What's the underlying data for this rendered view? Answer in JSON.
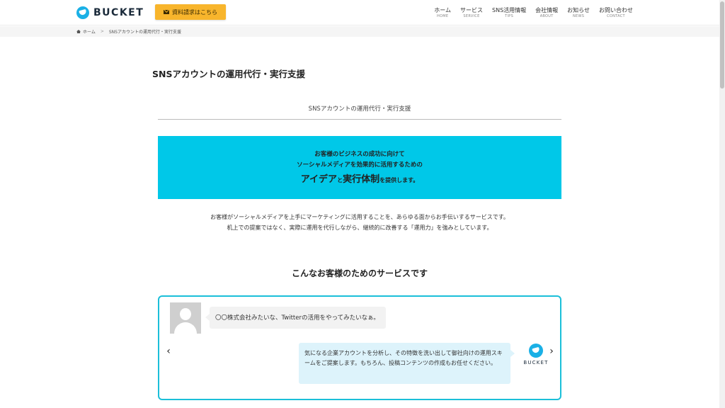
{
  "header": {
    "logo_text": "BUCKET",
    "cta_label": "資料請求はこちら",
    "nav": [
      {
        "jp": "ホーム",
        "en": "HOME"
      },
      {
        "jp": "サービス",
        "en": "SERVICE"
      },
      {
        "jp": "SNS活用情報",
        "en": "TIPS"
      },
      {
        "jp": "会社情報",
        "en": "ABOUT"
      },
      {
        "jp": "お知らせ",
        "en": "NEWS"
      },
      {
        "jp": "お問い合わせ",
        "en": "CONTACT"
      }
    ]
  },
  "breadcrumb": {
    "home": "ホーム",
    "separator": ">",
    "current": "SNSアカウントの運用代行・実行支援"
  },
  "page": {
    "title": "SNSアカウントの運用代行・実行支援",
    "section_heading": "SNSアカウントの運用代行・実行支援"
  },
  "banner": {
    "line1": "お客様のビジネスの成功に向けて",
    "line2": "ソーシャルメディアを効果的に活用するための",
    "big1": "アイデア",
    "small1": "と",
    "big2": "実行体制",
    "small2": "を提供します。",
    "bg_color": "#00c8e8"
  },
  "description": {
    "line1": "お客様がソーシャルメディアを上手にマーケティングに活用することを、あらゆる面からお手伝いするサービスです。",
    "line2": "机上での提案ではなく、実際に運用を代行しながら、継続的に改善する「運用力」を強みとしています。"
  },
  "services": {
    "title": "こんなお客様のためのサービスです",
    "carousel": {
      "prev_glyph": "‹",
      "next_glyph": "›",
      "customer_message": "〇〇株式会社みたいな、Twitterの活用をやってみたいなぁ。",
      "bucket_reply": "気になる企業アカウントを分析し、その特徴を洗い出して御社向けの運用スキームをご提案します。もちろん、投稿コンテンツの作成もお任せください。",
      "bucket_label": "BUCKET"
    }
  },
  "colors": {
    "accent": "#1bbfd9",
    "cta": "#f8b52c",
    "brand": "#1ab0e6"
  }
}
